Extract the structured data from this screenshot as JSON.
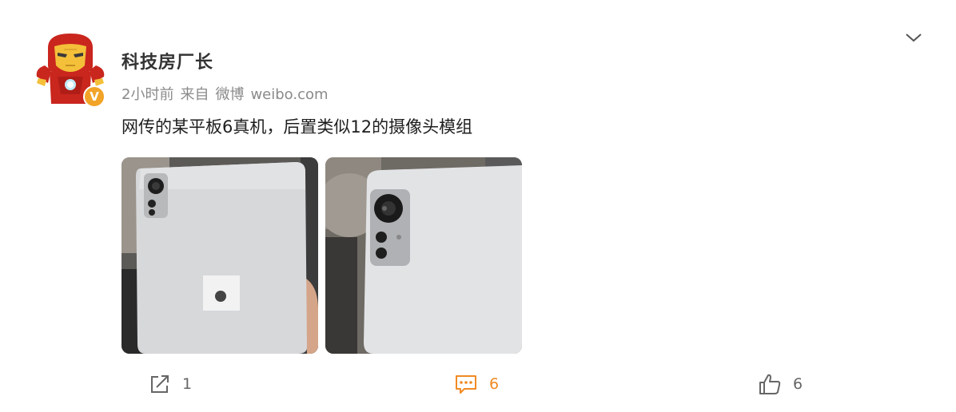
{
  "post": {
    "author": "科技房厂长",
    "time": "2小时前",
    "source_prefix": "来自",
    "source_app": "微博",
    "source_domain": "weibo.com",
    "text": "网传的某平板6真机，后置类似12的摄像头模组",
    "verified_badge": "V"
  },
  "actions": {
    "share_count": "1",
    "comment_count": "6",
    "like_count": "6"
  },
  "colors": {
    "accent_comment": "#f08a24",
    "verified_badge": "#f2a428",
    "text_meta": "#8a8a8a"
  },
  "icons": [
    "ironman-avatar",
    "verified-icon",
    "chevron-down-icon",
    "share-icon",
    "comment-icon",
    "like-icon"
  ]
}
